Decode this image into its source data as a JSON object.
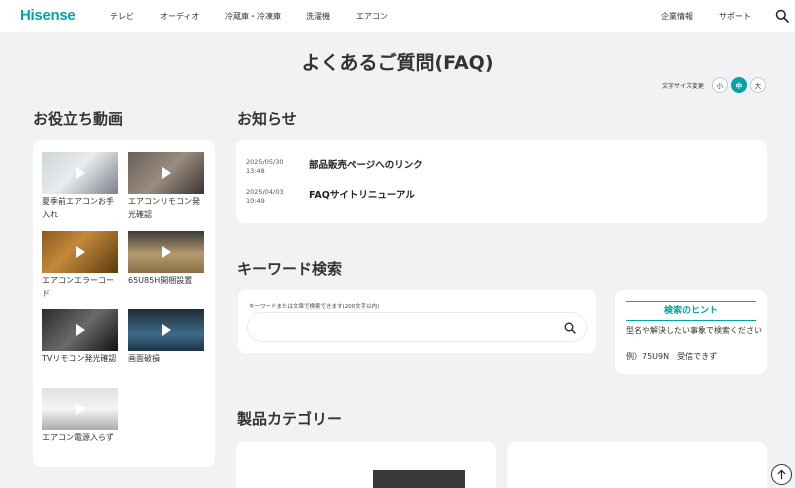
{
  "header": {
    "logo": "Hisense",
    "nav_left": [
      "テレビ",
      "オーディオ",
      "冷蔵庫・冷凍庫",
      "洗濯機",
      "エアコン"
    ],
    "nav_right": [
      "企業情報",
      "サポート"
    ],
    "search_icon": "search-icon"
  },
  "page_title": "よくあるご質問(FAQ)",
  "font_size": {
    "label": "文字サイズ変更",
    "options": [
      "小",
      "中",
      "大"
    ],
    "selected": "中"
  },
  "videos": {
    "title": "お役立ち動画",
    "items": [
      {
        "label": "夏季前エアコンお手入れ"
      },
      {
        "label": "エアコンリモコン発光確認"
      },
      {
        "label": "エアコンエラーコード"
      },
      {
        "label": "65U85H開梱設置"
      },
      {
        "label": "TVリモコン発光確認"
      },
      {
        "label": "画面破損"
      },
      {
        "label": "エアコン電源入らず"
      }
    ]
  },
  "news": {
    "title": "お知らせ",
    "items": [
      {
        "date": "2025/05/30",
        "time": "13:48",
        "title": "部品販売ページへのリンク"
      },
      {
        "date": "2025/04/03",
        "time": "10:49",
        "title": "FAQサイトリニューアル"
      }
    ]
  },
  "keyword_search": {
    "title": "キーワード検索",
    "label": "キーワードまたは文章で検索できます(200文字以内)",
    "value": "",
    "placeholder": ""
  },
  "hint": {
    "title": "検索のヒント",
    "text": "型名や解決したい事象で検索ください",
    "example": "例）75U9N　受信できず"
  },
  "category": {
    "title": "製品カテゴリー"
  },
  "colors": {
    "brand": "#00a3a6",
    "background": "#f2f2f4",
    "card": "#ffffff"
  }
}
